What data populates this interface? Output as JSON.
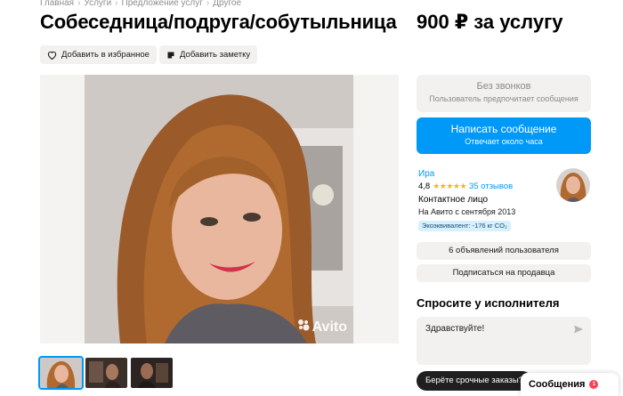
{
  "breadcrumb": [
    "Главная",
    "Услуги",
    "Предложение услуг",
    "Другое"
  ],
  "listing": {
    "title": "Собеседница/подруга/собутыльница",
    "price": "900 ₽ за услугу"
  },
  "actions": {
    "favorite_label": "Добавить в избранное",
    "note_label": "Добавить заметку"
  },
  "contact": {
    "no_calls_title": "Без звонков",
    "no_calls_subtitle": "Пользователь предпочитает сообщения",
    "write_label": "Написать сообщение",
    "write_subtitle": "Отвечает около часа"
  },
  "seller": {
    "name": "Ира",
    "rating": "4,8",
    "stars": "★★★★★",
    "reviews": "35 отзывов",
    "type": "Контактное лицо",
    "since": "На Авито с сентября 2013",
    "eco": "Экоэквивалент: -176 кг CO₂",
    "listings_label": "6 объявлений пользователя",
    "subscribe_label": "Подписаться на продавца"
  },
  "ask": {
    "title": "Спросите у исполнителя",
    "message": "Здравствуйте!"
  },
  "watermark": "Avito",
  "promo": {
    "urgent_label": "Берёте срочные заказы?"
  },
  "messages": {
    "label": "Сообщения",
    "badge": "1"
  },
  "colors": {
    "accent": "#0099f7",
    "star": "#ffb021",
    "badge": "#ff4053"
  }
}
